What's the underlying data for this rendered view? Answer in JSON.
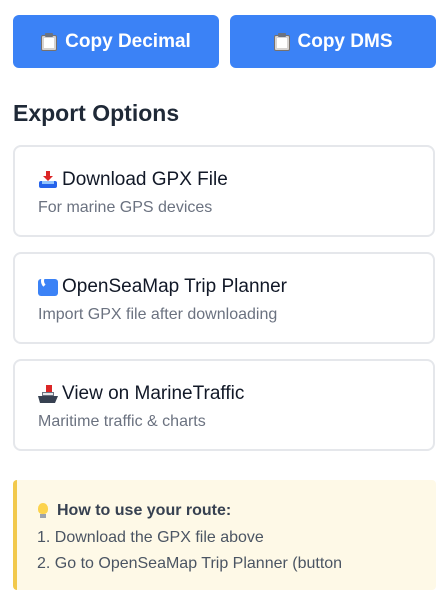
{
  "copy_buttons": [
    {
      "label": "Copy Decimal",
      "icon": "clipboard-icon"
    },
    {
      "label": "Copy DMS",
      "icon": "clipboard-icon"
    }
  ],
  "export": {
    "title": "Export Options",
    "options": [
      {
        "icon": "inbox-tray-icon",
        "title": "Download GPX File",
        "subtitle": "For marine GPS devices"
      },
      {
        "icon": "wave-icon",
        "title": "OpenSeaMap Trip Planner",
        "subtitle": "Import GPX file after downloading"
      },
      {
        "icon": "ship-icon",
        "title": "View on MarineTraffic",
        "subtitle": "Maritime traffic & charts"
      }
    ]
  },
  "howto": {
    "icon": "lightbulb-icon",
    "title": "How to use your route:",
    "steps": [
      "1. Download the GPX file above",
      "2. Go to OpenSeaMap Trip Planner (button"
    ]
  },
  "colors": {
    "primary": "#3b82f6",
    "card_border": "#e5e7eb",
    "note_bg": "#fef9e7",
    "note_accent": "#f2c94c"
  }
}
